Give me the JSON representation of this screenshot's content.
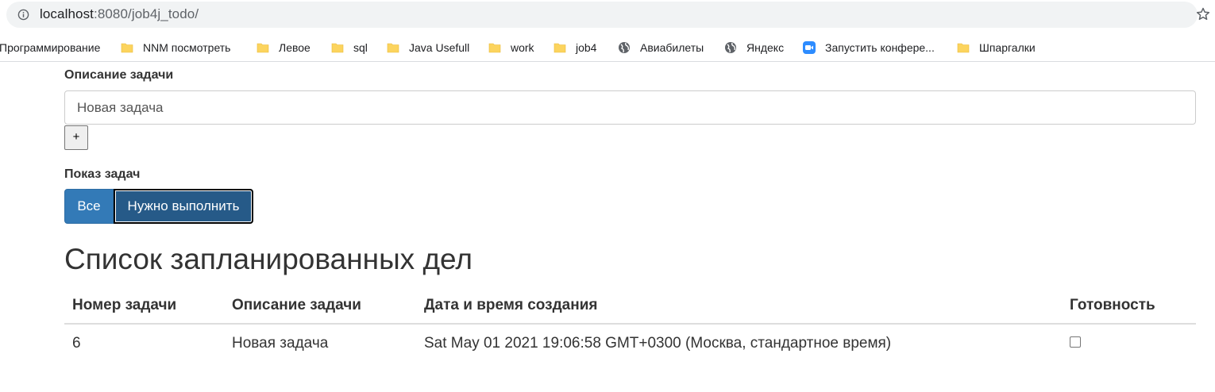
{
  "browser": {
    "url_host": "localhost",
    "url_rest": ":8080/job4j_todo/",
    "bookmarks": [
      {
        "label": "Программирование",
        "icon": "folder-icon"
      },
      {
        "label": "NNM посмотреть",
        "icon": "folder-icon"
      },
      {
        "label": "Левое",
        "icon": "folder-icon"
      },
      {
        "label": "sql",
        "icon": "folder-icon"
      },
      {
        "label": "Java Usefull",
        "icon": "folder-icon"
      },
      {
        "label": "work",
        "icon": "folder-icon"
      },
      {
        "label": "job4",
        "icon": "folder-icon"
      },
      {
        "label": "Авиабилеты",
        "icon": "globe-icon"
      },
      {
        "label": "Яндекс",
        "icon": "globe-icon"
      },
      {
        "label": "Запустить конфере...",
        "icon": "zoom-video-icon"
      },
      {
        "label": "Шпаргалки",
        "icon": "folder-icon"
      }
    ]
  },
  "form": {
    "description_label": "Описание задачи",
    "description_value": "Новая задача",
    "add_label": "+",
    "show_label": "Показ задач",
    "filter_all": "Все",
    "filter_todo": "Нужно выполнить"
  },
  "list": {
    "title": "Список запланированных дел",
    "columns": [
      "Номер задачи",
      "Описание задачи",
      "Дата и время создания",
      "Готовность"
    ],
    "rows": [
      {
        "id": "6",
        "description": "Новая задача",
        "created": "Sat May 01 2021 19:06:58 GMT+0300 (Москва, стандартное время)",
        "done": false
      }
    ]
  },
  "colors": {
    "primary": "#337ab7",
    "primary_active": "#265a88",
    "folder": "#fcd45e"
  }
}
